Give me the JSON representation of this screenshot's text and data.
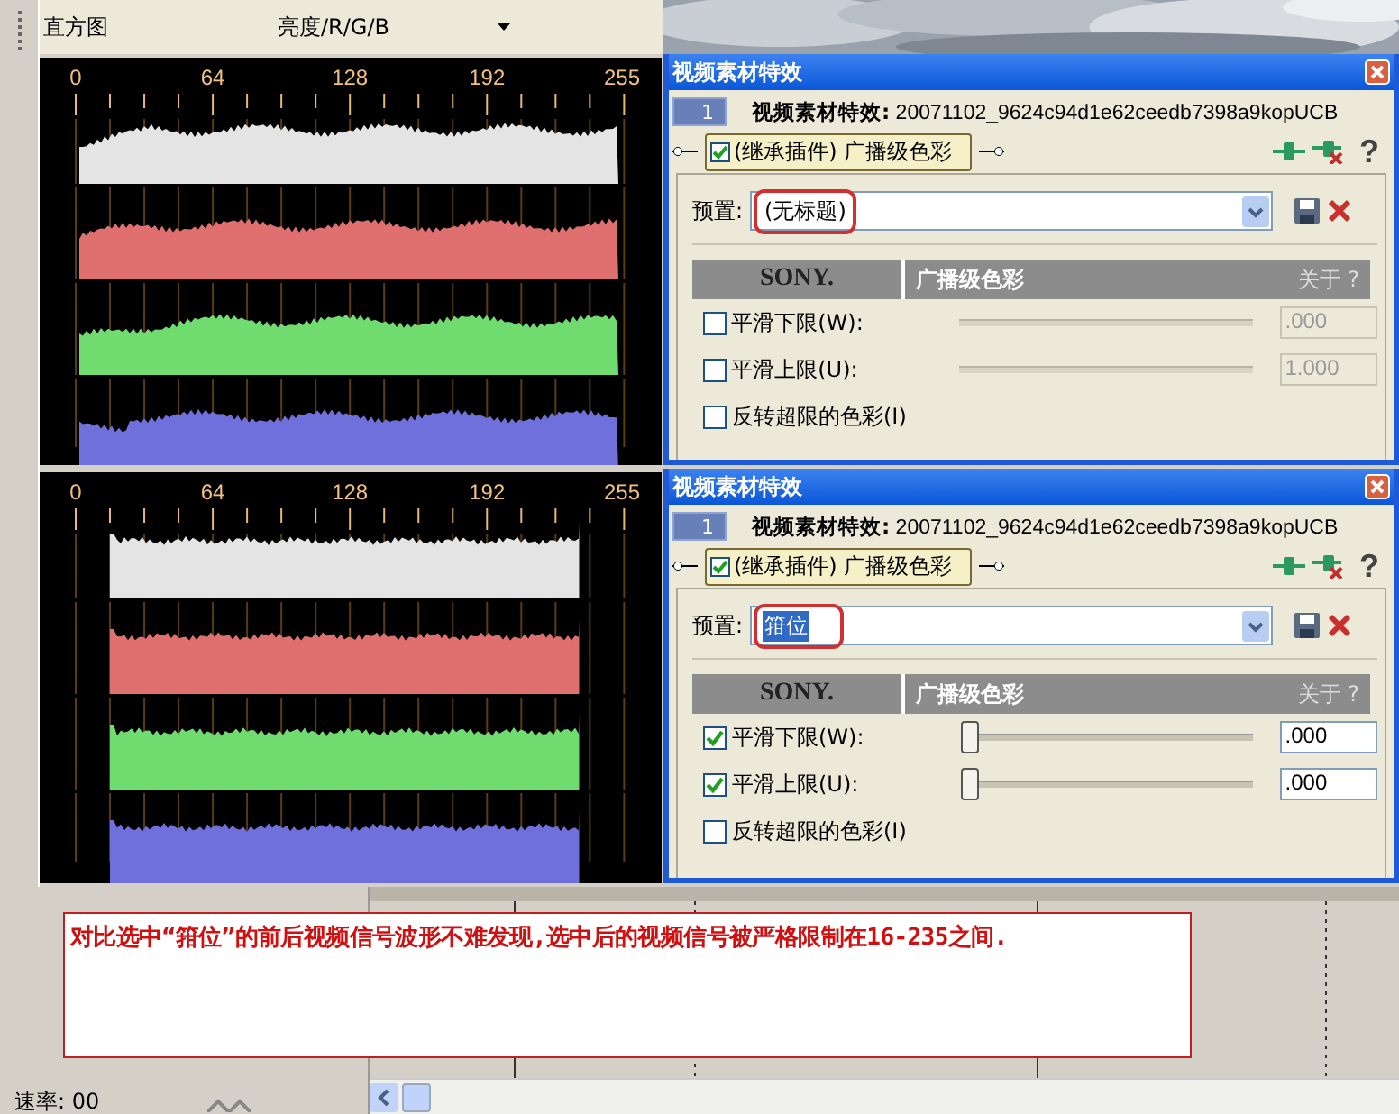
{
  "histogram_header": {
    "title": "直方图",
    "channel_dropdown": "亮度/R/G/B"
  },
  "histograms": [
    {
      "ticks": [
        "0",
        "64",
        "128",
        "192",
        "255"
      ],
      "clipped": false
    },
    {
      "ticks": [
        "0",
        "64",
        "128",
        "192",
        "255"
      ],
      "clipped": true
    }
  ],
  "dialogs": [
    {
      "title": "视频素材特效",
      "slot": "1",
      "header_label": "视频素材特效:",
      "header_file": "20071102_9624c94d1e62ceedb7398a9kopUCB",
      "plugin": {
        "label": "(继承插件) 广播级色彩",
        "checked": true
      },
      "help": "?",
      "preset_label": "预置:",
      "preset_value": "(无标题)",
      "preset_selected": false,
      "vendor": "SONY.",
      "effect_name": "广播级色彩",
      "about": "关于 ?",
      "params": [
        {
          "kind": "slider",
          "label": "平滑下限(W):",
          "checked": false,
          "value": ".000"
        },
        {
          "kind": "slider",
          "label": "平滑上限(U):",
          "checked": false,
          "value": "1.000"
        },
        {
          "kind": "toggle",
          "label": "反转超限的色彩(I)",
          "checked": false
        }
      ]
    },
    {
      "title": "视频素材特效",
      "slot": "1",
      "header_label": "视频素材特效:",
      "header_file": "20071102_9624c94d1e62ceedb7398a9kopUCB",
      "plugin": {
        "label": "(继承插件) 广播级色彩",
        "checked": true
      },
      "help": "?",
      "preset_label": "预置:",
      "preset_value": "箝位",
      "preset_selected": true,
      "vendor": "SONY.",
      "effect_name": "广播级色彩",
      "about": "关于 ?",
      "params": [
        {
          "kind": "slider",
          "label": "平滑下限(W):",
          "checked": true,
          "level": 0,
          "value": ".000"
        },
        {
          "kind": "slider",
          "label": "平滑上限(U):",
          "checked": true,
          "level": 0,
          "value": ".000"
        },
        {
          "kind": "toggle",
          "label": "反转超限的色彩(I)",
          "checked": false
        }
      ]
    }
  ],
  "note": "对比选中“箝位”的前后视频信号波形不难发现,选中后的视频信号被严格限制在16-235之间.",
  "rate": "速率: 00"
}
